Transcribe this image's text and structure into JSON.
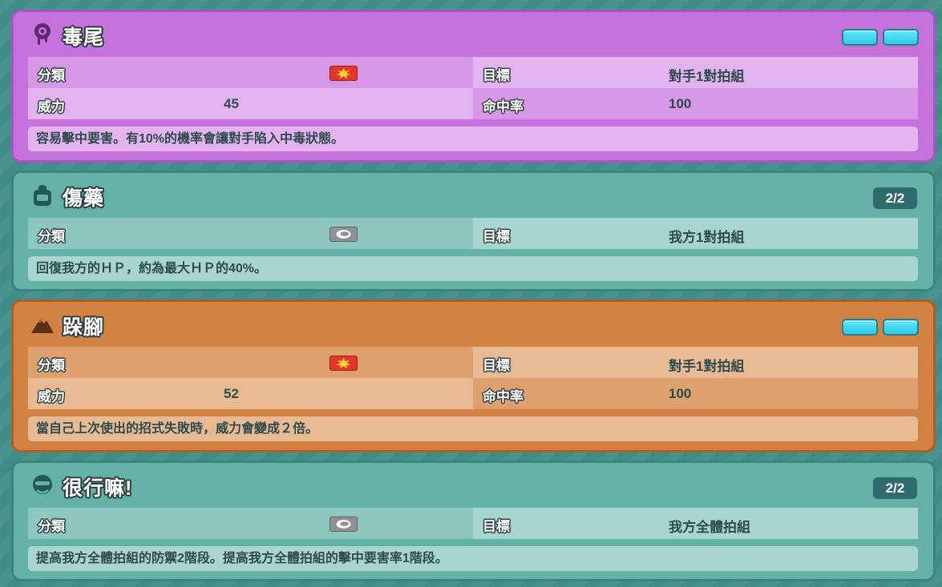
{
  "moves": [
    {
      "name": "毒尾",
      "type_icon": "poison-type-icon",
      "pp_display": "bars",
      "pp_text": "",
      "category_icon": "physical-category-icon",
      "category_label": "分類",
      "target_label": "目標",
      "target_value": "對手1對拍組",
      "power_label": "威力",
      "power_value": "45",
      "accuracy_label": "命中率",
      "accuracy_value": "100",
      "description": "容易擊中要害。有10%的機率會讓對手陷入中毒狀態。"
    },
    {
      "name": "傷藥",
      "type_icon": "bag-item-icon",
      "pp_display": "badge",
      "pp_text": "2/2",
      "category_icon": "status-category-icon",
      "category_label": "分類",
      "target_label": "目標",
      "target_value": "我方1對拍組",
      "description": "回復我方的ＨＰ，約為最大ＨＰ的40%。"
    },
    {
      "name": "跺腳",
      "type_icon": "ground-type-icon",
      "pp_display": "bars",
      "pp_text": "",
      "category_icon": "physical-category-icon",
      "category_label": "分類",
      "target_label": "目標",
      "target_value": "對手1對拍組",
      "power_label": "威力",
      "power_value": "52",
      "accuracy_label": "命中率",
      "accuracy_value": "100",
      "description": "當自己上次使出的招式失敗時，威力會變成２倍。"
    },
    {
      "name": "很行嘛!",
      "type_icon": "trainer-cheer-icon",
      "pp_display": "badge",
      "pp_text": "2/2",
      "category_icon": "status-category-icon",
      "category_label": "分類",
      "target_label": "目標",
      "target_value": "我方全體拍組",
      "description": "提高我方全體拍組的防禦2階段。提高我方全體拍組的擊中要害率1階段。"
    }
  ],
  "colors": {
    "poison": "#c572dc",
    "heal": "#64b1a6",
    "ground": "#d28344",
    "pp_bar": "#2ccbea",
    "physical": "#e4352a",
    "status": "#8e9293"
  }
}
